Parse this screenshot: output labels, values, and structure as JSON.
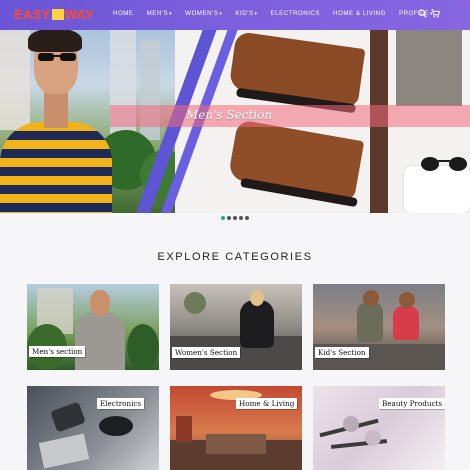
{
  "brand": {
    "word1": "EASY",
    "word2": "WAY"
  },
  "nav": {
    "items": [
      {
        "label": "HOME",
        "dropdown": false
      },
      {
        "label": "MEN'S",
        "dropdown": true
      },
      {
        "label": "WOMEN'S",
        "dropdown": true
      },
      {
        "label": "KID'S",
        "dropdown": true
      },
      {
        "label": "ELECTRONICS",
        "dropdown": false
      },
      {
        "label": "HOME & LIVING",
        "dropdown": false
      },
      {
        "label": "PROFILE",
        "dropdown": true
      }
    ],
    "icons": [
      "search-icon",
      "cart-icon"
    ]
  },
  "hero": {
    "title": "Men's Section",
    "slides_count": 5,
    "active_slide": 1
  },
  "categories": {
    "heading": "EXPLORE CATEGORIES",
    "items": [
      {
        "label": "Men's section"
      },
      {
        "label": "Women's Section"
      },
      {
        "label": "Kid's Section"
      },
      {
        "label": "Electronics"
      },
      {
        "label": "Home & Living"
      },
      {
        "label": "Beauty Products"
      }
    ]
  },
  "colors": {
    "navbar": "#7b5fdc",
    "logo_text": "#ff4b2b",
    "logo_mark": "#ffd23f",
    "active_dot": "#27a2a0"
  }
}
